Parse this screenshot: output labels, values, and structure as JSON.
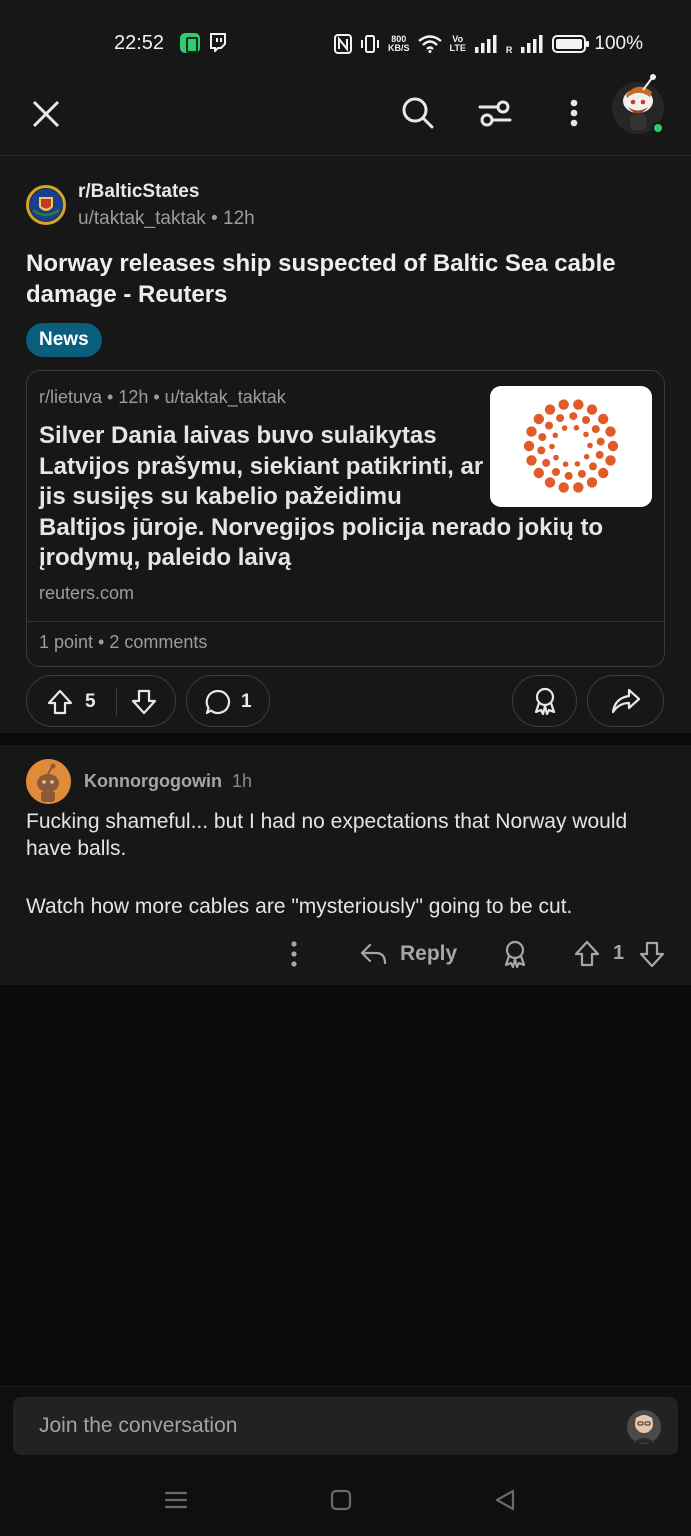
{
  "status_bar": {
    "time": "22:52",
    "speed_value": "800",
    "speed_unit": "KB/S",
    "volte_top": "Vo",
    "volte_bottom": "LTE",
    "roaming": "R",
    "battery": "100%"
  },
  "app_bar": {
    "icons": [
      "close-icon",
      "search-icon",
      "filter-icon",
      "more-vertical-icon",
      "user-avatar"
    ]
  },
  "post": {
    "subreddit": "r/BalticStates",
    "author": "u/taktak_taktak",
    "age": "12h",
    "meta_separator": "•",
    "title": "Norway releases ship suspected of Baltic Sea cable damage - Reuters",
    "flair": "News",
    "crosspost": {
      "meta": "r/lietuva • 12h • u/taktak_taktak",
      "title_narrow": "Silver Dania laivas buvo sulaikytas Latvijos prašymu, siekiant patikrinti, ar jis susijęs su kabelio pažeidimu",
      "title_wide": "Baltijos jūroje. Norvegijos policija nerado jokių to įrodymų, paleido laivą",
      "domain": "reuters.com",
      "stats": "1 point • 2 comments"
    },
    "score": "5",
    "comments": "1"
  },
  "comment": {
    "author": "Konnorgogowin",
    "age": "1h",
    "paragraphs": [
      "Fucking shameful... but I had no expectations that Norway would have balls.",
      "Watch how more cables are \"mysteriously\" going to be cut."
    ],
    "reply_label": "Reply",
    "score": "1"
  },
  "composer": {
    "placeholder": "Join the conversation"
  },
  "colors": {
    "background": "#171717",
    "flair": "#0a5f7e",
    "text": "#e4e6e8",
    "muted": "#9a9da0",
    "online_dot": "#2ecc71"
  }
}
